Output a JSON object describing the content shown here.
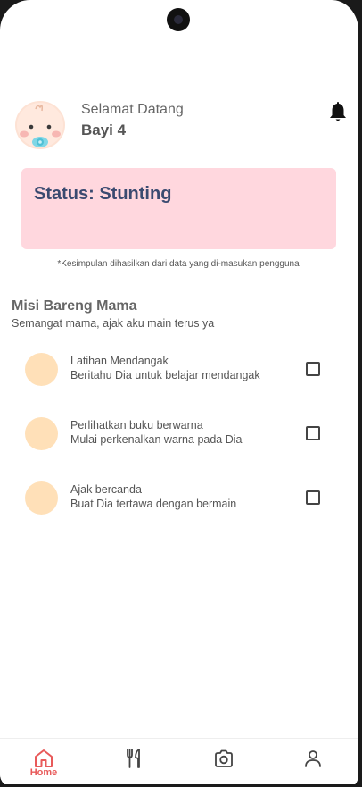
{
  "header": {
    "greeting": "Selamat Datang",
    "baby_name": "Bayi 4"
  },
  "status": {
    "title": "Status: Stunting",
    "note": "*Kesimpulan dihasilkan dari data yang di-masukan pengguna"
  },
  "missions": {
    "title": "Misi Bareng Mama",
    "subtitle": "Semangat mama, ajak aku main terus ya",
    "items": [
      {
        "title": "Latihan Mendangak",
        "desc": "Beritahu Dia untuk belajar mendangak",
        "checked": false
      },
      {
        "title": "Perlihatkan buku berwarna",
        "desc": "Mulai perkenalkan warna pada Dia",
        "checked": false
      },
      {
        "title": "Ajak bercanda",
        "desc": "Buat Dia tertawa dengan bermain",
        "checked": false
      }
    ]
  },
  "nav": {
    "items": [
      {
        "label": "Home",
        "icon": "home-icon",
        "active": true
      },
      {
        "label": "",
        "icon": "fork-knife-icon",
        "active": false
      },
      {
        "label": "",
        "icon": "camera-icon",
        "active": false
      },
      {
        "label": "",
        "icon": "profile-icon",
        "active": false
      }
    ]
  },
  "colors": {
    "status_bg": "#ffd7de",
    "status_text": "#3a4a70",
    "mission_dot": "#ffe0b8",
    "nav_active": "#e85a5a"
  }
}
